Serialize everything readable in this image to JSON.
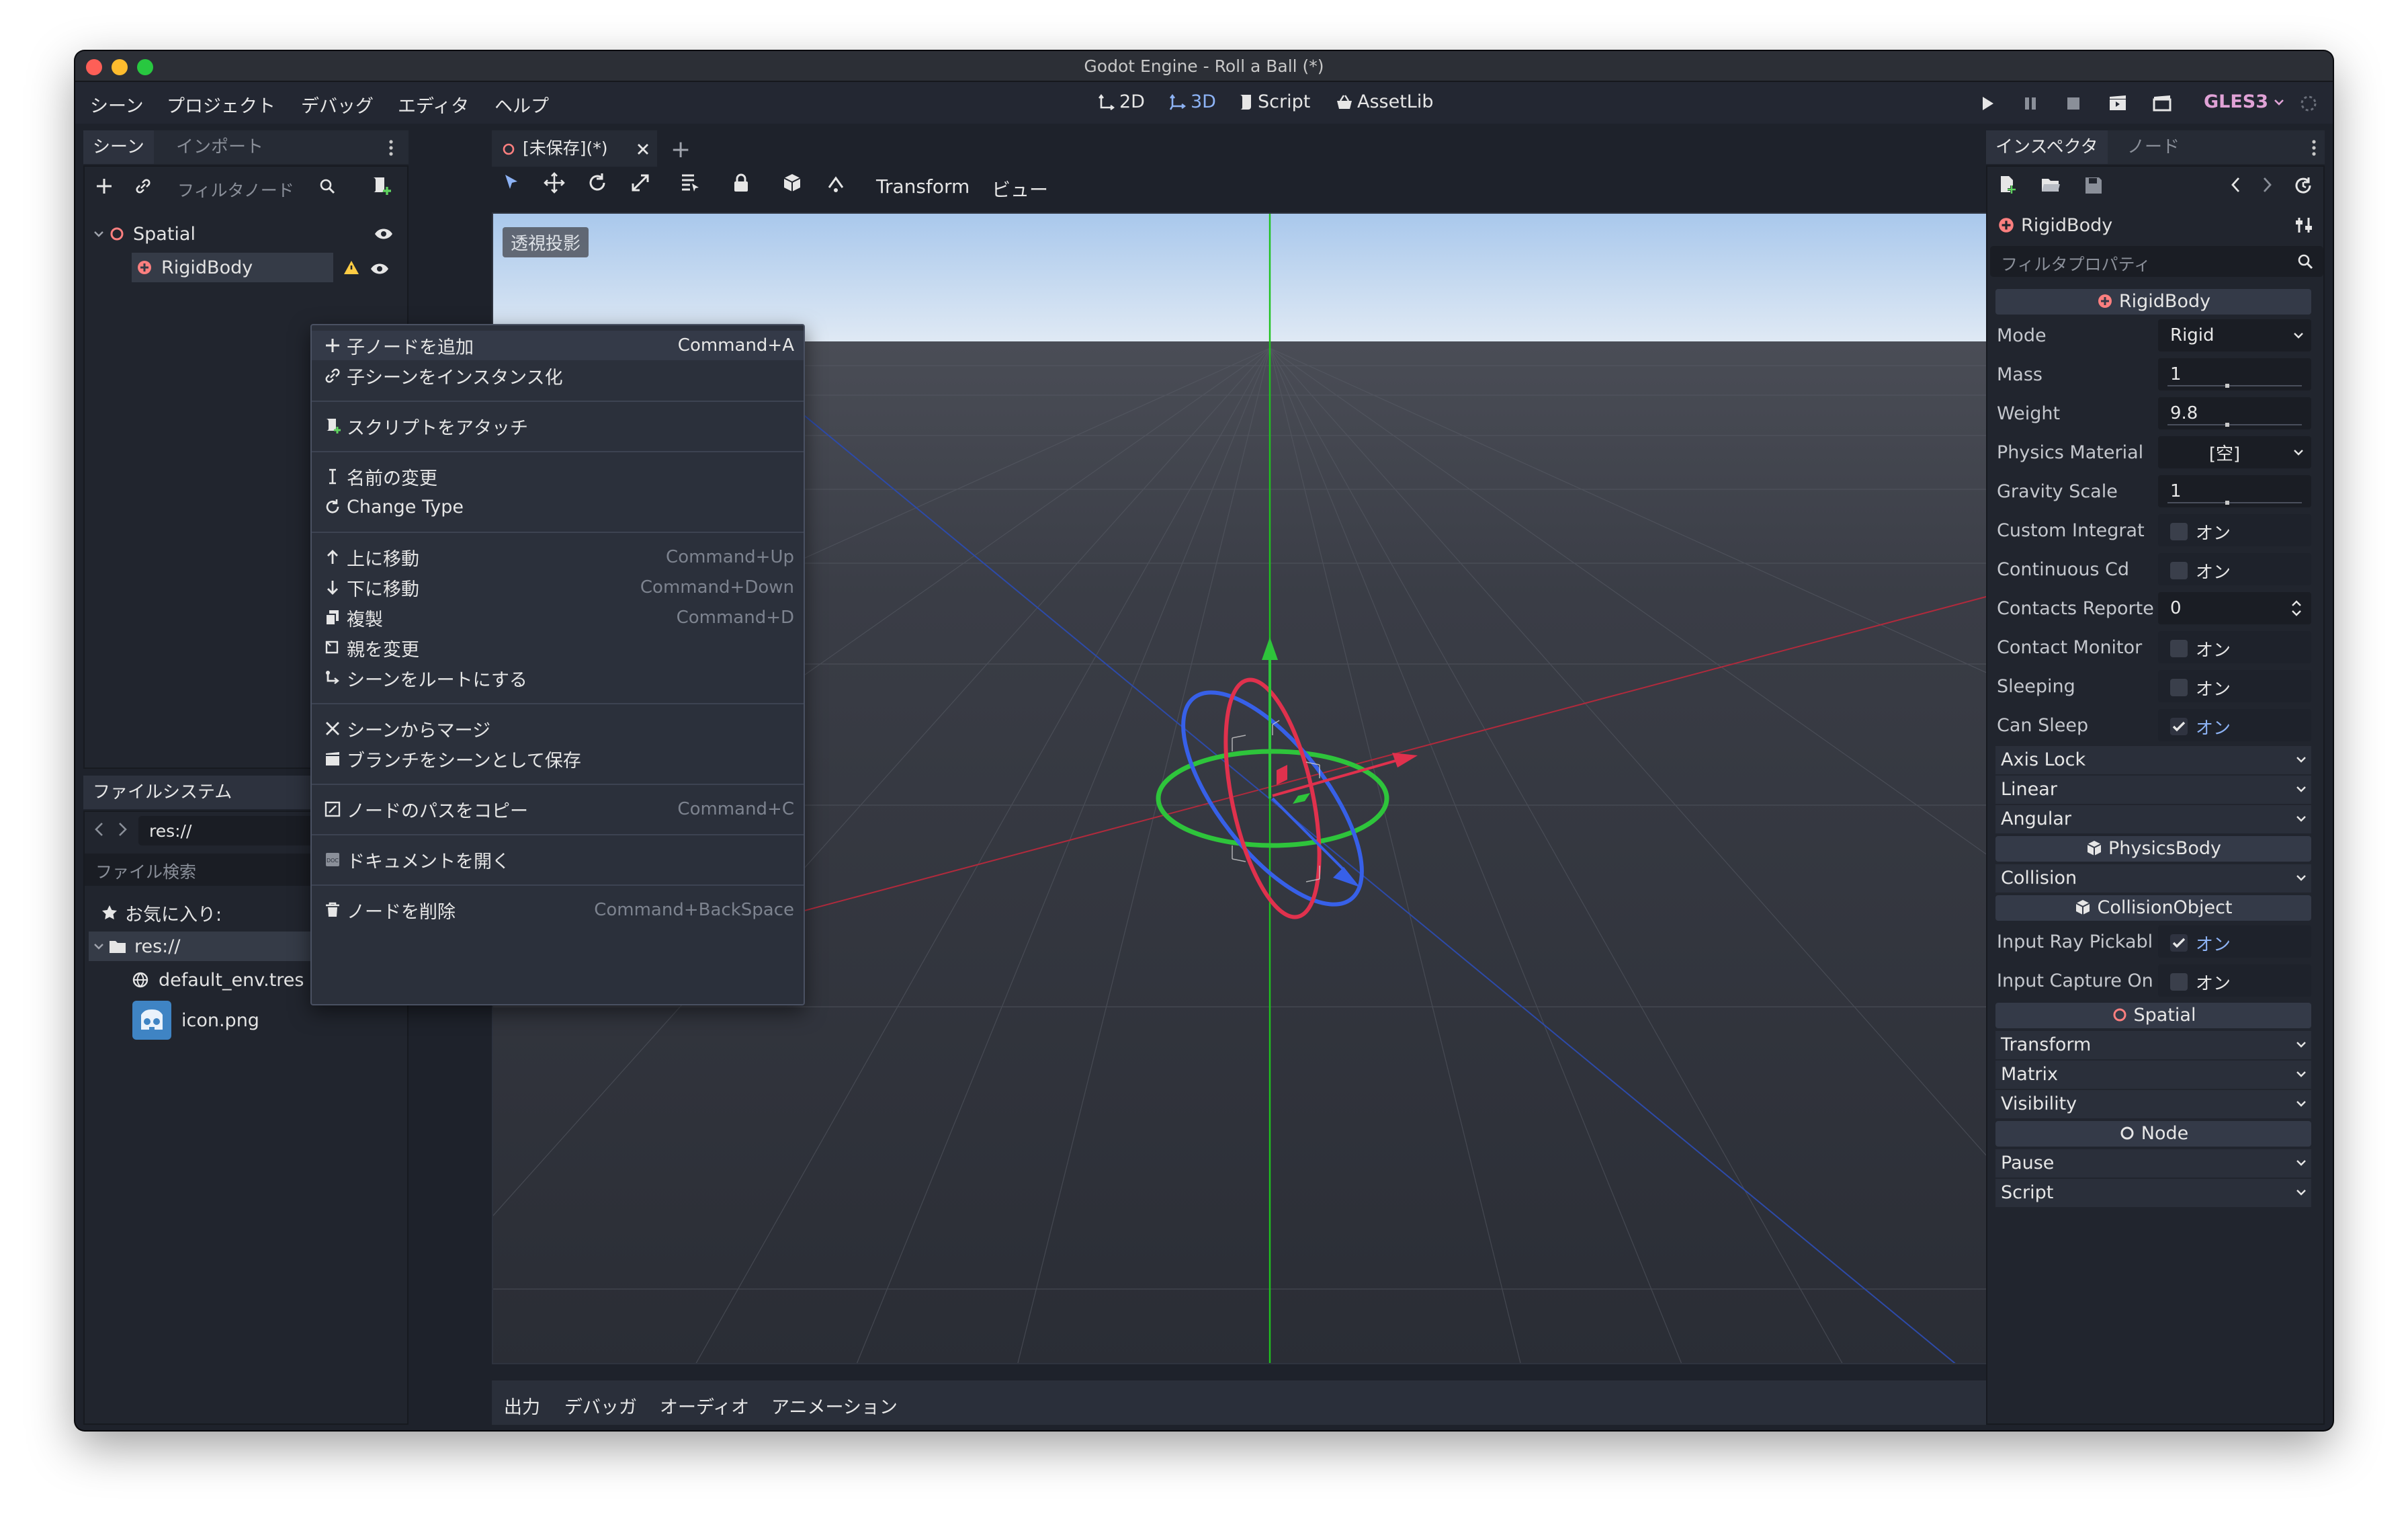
{
  "window": {
    "title": "Godot Engine - Roll a Ball (*)"
  },
  "menubar": {
    "menus": [
      "シーン",
      "プロジェクト",
      "デバッグ",
      "エディタ",
      "ヘルプ"
    ],
    "modes": [
      "2D",
      "3D",
      "Script",
      "AssetLib"
    ],
    "active_mode": "3D",
    "renderer": "GLES3"
  },
  "scene_dock": {
    "tabs": [
      "シーン",
      "インポート"
    ],
    "filter_placeholder": "フィルタノード",
    "tree": [
      {
        "name": "Spatial",
        "icon": "spatial-node-icon"
      },
      {
        "name": "RigidBody",
        "icon": "rigidbody-icon",
        "selected": true,
        "warning": true
      }
    ]
  },
  "filesystem_dock": {
    "title": "ファイルシステム",
    "path": "res://",
    "search_placeholder": "ファイル検索",
    "favorites": "お気に入り:",
    "items": [
      {
        "name": "res://",
        "icon": "folder-icon"
      },
      {
        "name": "default_env.tres",
        "icon": "environment-icon"
      },
      {
        "name": "icon.png",
        "icon": "godot-logo-icon"
      }
    ]
  },
  "editor_tabs": {
    "tabs": [
      "[未保存](*)"
    ],
    "add_tab": "+"
  },
  "viewport_toolbar": {
    "transform_menu": "Transform",
    "view_menu": "ビュー"
  },
  "viewport": {
    "perspective_label": "透視投影"
  },
  "context_menu": {
    "groups": [
      [
        {
          "label": "子ノードを追加",
          "shortcut": "Command+A",
          "icon": "add-icon"
        },
        {
          "label": "子シーンをインスタンス化",
          "shortcut": "",
          "icon": "link-icon"
        }
      ],
      [
        {
          "label": "スクリプトをアタッチ",
          "shortcut": "",
          "icon": "script-add-icon"
        }
      ],
      [
        {
          "label": "名前の変更",
          "shortcut": "",
          "icon": "rename-icon"
        },
        {
          "label": "Change Type",
          "shortcut": "",
          "icon": "reload-icon"
        }
      ],
      [
        {
          "label": "上に移動",
          "shortcut": "Command+Up",
          "icon": "arrow-up-icon"
        },
        {
          "label": "下に移動",
          "shortcut": "Command+Down",
          "icon": "arrow-down-icon"
        },
        {
          "label": "複製",
          "shortcut": "Command+D",
          "icon": "duplicate-icon"
        },
        {
          "label": "親を変更",
          "shortcut": "",
          "icon": "reparent-icon"
        },
        {
          "label": "シーンをルートにする",
          "shortcut": "",
          "icon": "make-root-icon"
        }
      ],
      [
        {
          "label": "シーンからマージ",
          "shortcut": "",
          "icon": "merge-icon"
        },
        {
          "label": "ブランチをシーンとして保存",
          "shortcut": "",
          "icon": "save-branch-icon"
        }
      ],
      [
        {
          "label": "ノードのパスをコピー",
          "shortcut": "Command+C",
          "icon": "copy-path-icon"
        }
      ],
      [
        {
          "label": "ドキュメントを開く",
          "shortcut": "",
          "icon": "doc-icon"
        }
      ],
      [
        {
          "label": "ノードを削除",
          "shortcut": "Command+BackSpace",
          "icon": "trash-icon"
        }
      ]
    ]
  },
  "bottom_panel": {
    "tabs": [
      "出力",
      "デバッガ",
      "オーディオ",
      "アニメーション"
    ]
  },
  "inspector": {
    "tabs": [
      "インスペクタ",
      "ノード"
    ],
    "object_name": "RigidBody",
    "filter_placeholder": "フィルタプロパティ",
    "sections": [
      {
        "kind": "section",
        "label": "RigidBody",
        "icon": "rigidbody-icon"
      },
      {
        "kind": "select",
        "label": "Mode",
        "value": "Rigid"
      },
      {
        "kind": "slider",
        "label": "Mass",
        "value": "1"
      },
      {
        "kind": "slider",
        "label": "Weight",
        "value": "9.8"
      },
      {
        "kind": "resource",
        "label": "Physics Material",
        "value": "[空]"
      },
      {
        "kind": "slider",
        "label": "Gravity Scale",
        "value": "1"
      },
      {
        "kind": "check",
        "label": "Custom Integrat",
        "value": "オン",
        "checked": false
      },
      {
        "kind": "check",
        "label": "Continuous Cd",
        "value": "オン",
        "checked": false
      },
      {
        "kind": "spin",
        "label": "Contacts Reporte",
        "value": "0"
      },
      {
        "kind": "check",
        "label": "Contact Monitor",
        "value": "オン",
        "checked": false
      },
      {
        "kind": "check",
        "label": "Sleeping",
        "value": "オン",
        "checked": false
      },
      {
        "kind": "check",
        "label": "Can Sleep",
        "value": "オン",
        "checked": true
      },
      {
        "kind": "group",
        "label": "Axis Lock"
      },
      {
        "kind": "group",
        "label": "Linear"
      },
      {
        "kind": "group",
        "label": "Angular"
      },
      {
        "kind": "section",
        "label": "PhysicsBody",
        "icon": "physicsbody-icon"
      },
      {
        "kind": "group",
        "label": "Collision"
      },
      {
        "kind": "section",
        "label": "CollisionObject",
        "icon": "collisionobject-icon"
      },
      {
        "kind": "check",
        "label": "Input Ray Pickabl",
        "value": "オン",
        "checked": true
      },
      {
        "kind": "check",
        "label": "Input Capture On",
        "value": "オン",
        "checked": false
      },
      {
        "kind": "section",
        "label": "Spatial",
        "icon": "spatial-node-icon"
      },
      {
        "kind": "group",
        "label": "Transform"
      },
      {
        "kind": "group",
        "label": "Matrix"
      },
      {
        "kind": "group",
        "label": "Visibility"
      },
      {
        "kind": "section",
        "label": "Node",
        "icon": "node-icon"
      },
      {
        "kind": "group",
        "label": "Pause"
      },
      {
        "kind": "group",
        "label": "Script"
      }
    ]
  },
  "colors": {
    "accent": "#8db3f5",
    "gizmo_x": "#e0314d",
    "gizmo_y": "#2ec43b",
    "gizmo_z": "#3760e8",
    "warning": "#ffcc44",
    "renderer": "#e0a2d6",
    "node_red": "#fc7f7f"
  }
}
